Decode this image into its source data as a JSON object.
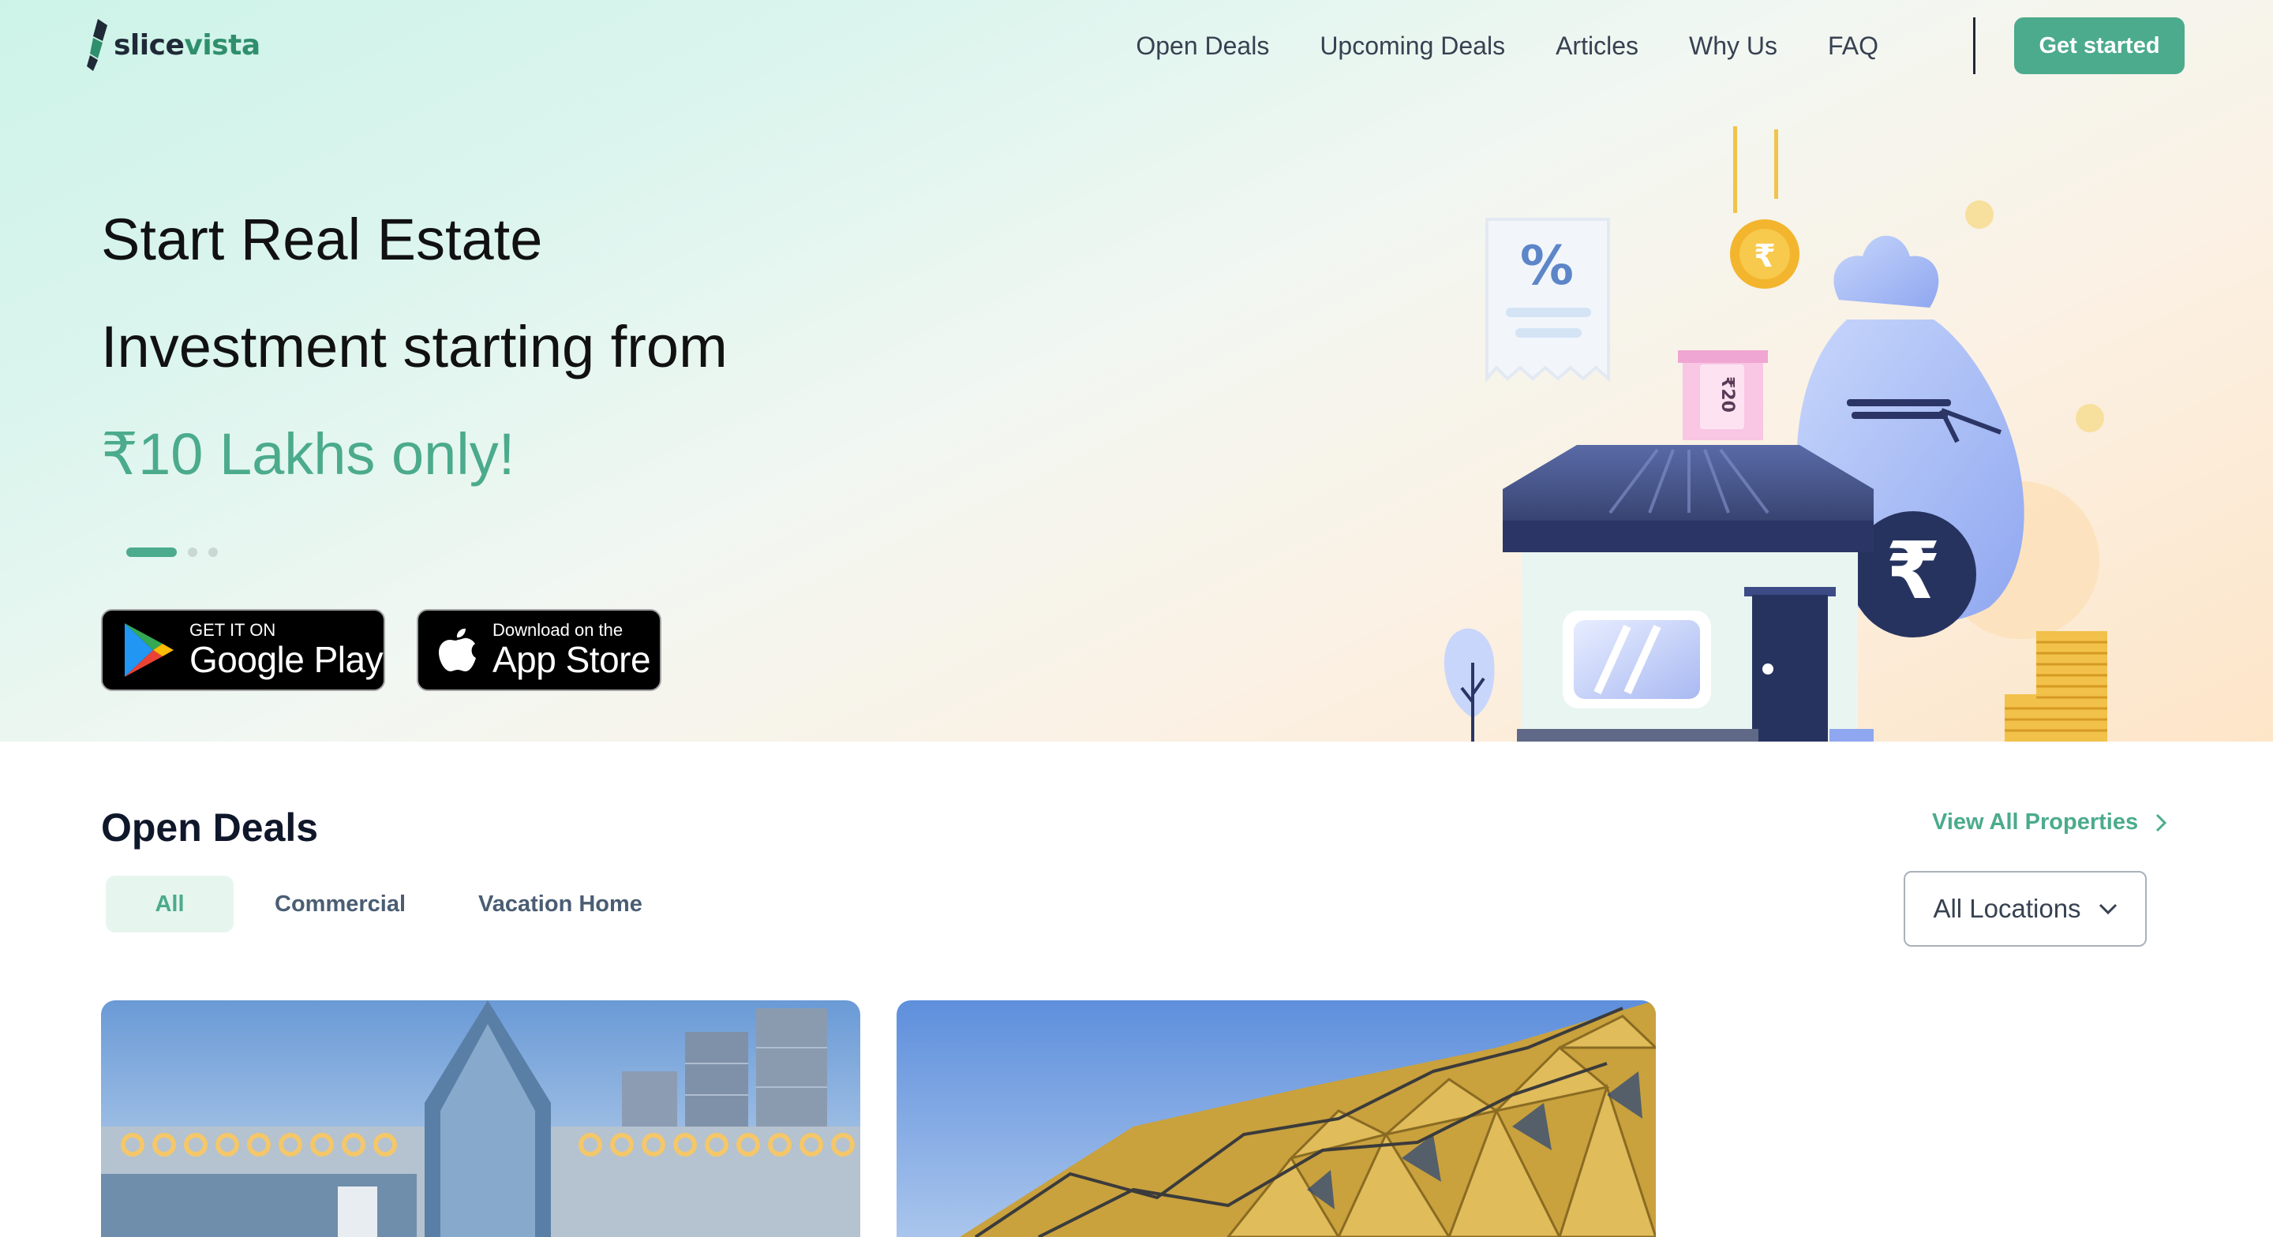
{
  "brand": {
    "name_part1": "slice",
    "name_part2": "vista",
    "accent_color": "#4bab8c"
  },
  "nav": {
    "links": [
      "Open Deals",
      "Upcoming Deals",
      "Articles",
      "Why Us",
      "FAQ"
    ],
    "cta": "Get started"
  },
  "hero": {
    "line1": "Start Real Estate",
    "line2": "Investment starting from",
    "highlight": "₹10 Lakhs only!",
    "slides_total": 3,
    "slide_active": 1,
    "google_play": {
      "small": "GET IT ON",
      "big": "Google Play"
    },
    "app_store": {
      "small": "Download on the",
      "big": "App Store"
    },
    "illustration_icons": [
      "percent-receipt-icon",
      "rupee-coin-icon",
      "banknote-icon",
      "house-icon",
      "money-bag-icon",
      "coin-stack-icon",
      "tree-icon"
    ]
  },
  "open_deals": {
    "title": "Open Deals",
    "view_all": "View All Properties",
    "tabs": [
      "All",
      "Commercial",
      "Vacation Home"
    ],
    "active_tab": "All",
    "location_filter": "All Locations"
  }
}
